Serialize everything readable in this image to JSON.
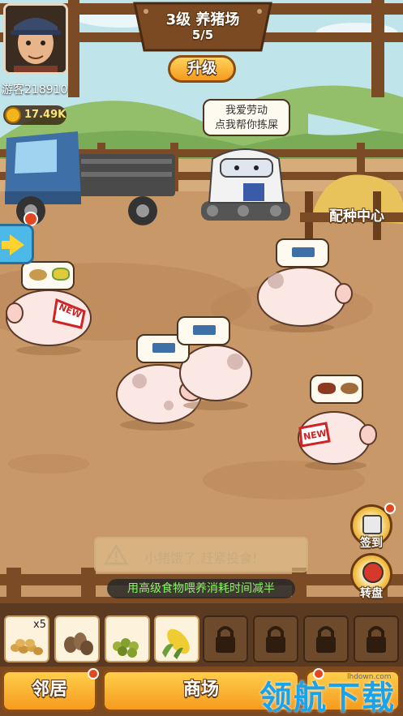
{
  "player": {
    "name": "游客218910",
    "coins": "17.49K"
  },
  "farm": {
    "title": "3级 养猪场",
    "count": "5/5",
    "upgrade_label": "升级"
  },
  "robot": {
    "speech_line1": "我爱劳动",
    "speech_line2": "点我帮你拣屎"
  },
  "breeding_center_label": "配种中心",
  "pigs": [
    {
      "badge": "NEW",
      "wants": [
        "grain-icon",
        "corn-icon"
      ]
    },
    {
      "badge": "",
      "wants": [
        "truck-icon"
      ]
    },
    {
      "badge": "",
      "wants": [
        "truck-icon"
      ]
    },
    {
      "badge": "",
      "wants": [
        "truck-icon"
      ]
    },
    {
      "badge": "NEW",
      "wants": [
        "meat-icon",
        "grain-icon"
      ]
    }
  ],
  "side_buttons": {
    "checkin_label": "签到",
    "wheel_label": "转盘"
  },
  "warning_text": "小猪饿了,赶紧投食!",
  "tip_text": "用高级食物喂养消耗时间减半",
  "inventory": {
    "first_count": "x5",
    "slots": [
      "beans-icon",
      "seeds-icon",
      "peas-icon",
      "corn-icon",
      "lock-icon",
      "lock-icon",
      "lock-icon",
      "lock-icon"
    ]
  },
  "nav": {
    "neighbors_label": "邻居",
    "shop_label": "商场",
    "third_label": ""
  },
  "watermark": {
    "text": "领航下载",
    "url": "lhdown.com"
  },
  "colors": {
    "ground": "#c99868",
    "sky": "#bfe4ea",
    "button_orange": "#f59b1e",
    "tip_green": "#8cf26a"
  }
}
